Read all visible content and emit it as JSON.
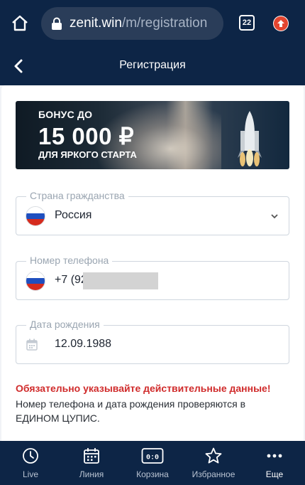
{
  "browser": {
    "url_host": "zenit.win",
    "url_path": "/m/registration",
    "tab_count": "22"
  },
  "header": {
    "title": "Регистрация"
  },
  "banner": {
    "line1": "БОНУС ДО",
    "line2": "15 000 ₽",
    "line3": "ДЛЯ ЯРКОГО СТАРТА"
  },
  "form": {
    "country": {
      "label": "Страна гражданства",
      "value": "Россия"
    },
    "phone": {
      "label": "Номер телефона",
      "value": "+7 (92"
    },
    "birthdate": {
      "label": "Дата рождения",
      "value": "12.09.1988"
    }
  },
  "warning": {
    "title": "Обязательно указывайте действительные данные!",
    "text": "Номер телефона и дата рождения проверяются в ЕДИНОМ ЦУПИС."
  },
  "nav": [
    {
      "label": "Live",
      "icon": "clock-icon"
    },
    {
      "label": "Линия",
      "icon": "calendar-icon"
    },
    {
      "label": "Корзина",
      "icon": "scoreboard-icon",
      "badge": "0:0"
    },
    {
      "label": "Избранное",
      "icon": "star-icon"
    },
    {
      "label": "Еще",
      "icon": "more-icon"
    }
  ],
  "colors": {
    "dark_navy": "#0d2546",
    "warning_red": "#d02b2b",
    "flag_blue": "#1f4fbf",
    "flag_red": "#d52b1e"
  }
}
